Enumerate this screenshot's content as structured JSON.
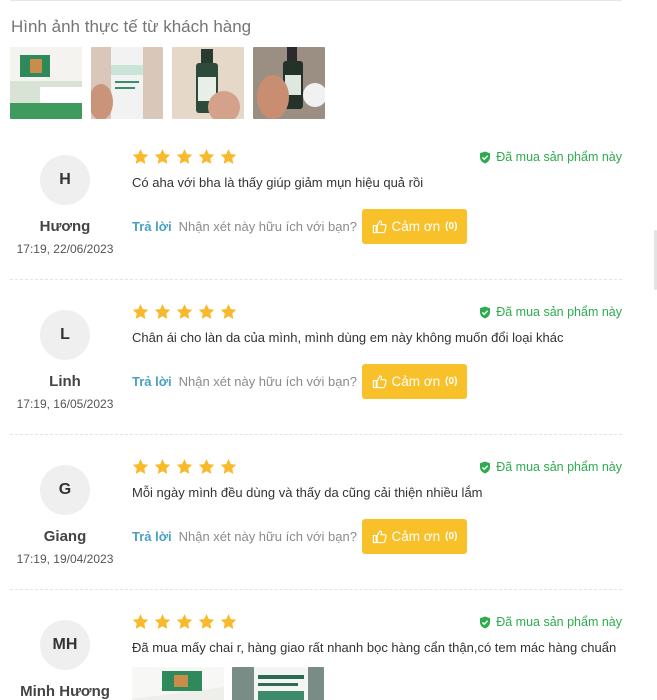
{
  "photos_section": {
    "title": "Hình ảnh thực tế từ khách hàng",
    "photos": [
      {
        "icon": "product-photo-box"
      },
      {
        "icon": "product-photo-bottle-hand"
      },
      {
        "icon": "product-photo-bottle-dark"
      },
      {
        "icon": "product-photo-bottle-hand-2"
      }
    ]
  },
  "labels": {
    "verified": "Đã mua sản phẩm này",
    "reply": "Trả lời",
    "helpful_question": "Nhận xét này hữu ích với bạn?",
    "thank": "Cảm ơn",
    "thank_count": "(0)"
  },
  "reviews": [
    {
      "initials": "H",
      "name": "Hương",
      "date": "17:19, 22/06/2023",
      "rating": 5,
      "text": "Có aha với bha là thấy giúp giảm mụn hiệu quả rồi"
    },
    {
      "initials": "L",
      "name": "Linh",
      "date": "17:19, 16/05/2023",
      "rating": 5,
      "text": "Chân ái cho làn da của mình, mình dùng em này không muốn đổi loại khác"
    },
    {
      "initials": "G",
      "name": "Giang",
      "date": "17:19, 19/04/2023",
      "rating": 5,
      "text": "Mỗi ngày mình đều dùng và thấy da cũng cải thiện nhiều lắm"
    },
    {
      "initials": "MH",
      "name": "Minh Hương",
      "rating": 5,
      "text": "Đã mua mấy chai r, hàng giao rất nhanh bọc hàng cẩn thận,có tem mác hàng chuẩn",
      "photos": [
        {
          "icon": "product-photo-box"
        },
        {
          "icon": "product-photo-bottle-label"
        }
      ]
    }
  ],
  "colors": {
    "star": "#f8b92b",
    "verified": "#2eab4f",
    "reply_link": "#4a9fc5",
    "thank_button": "#f8c12a"
  }
}
